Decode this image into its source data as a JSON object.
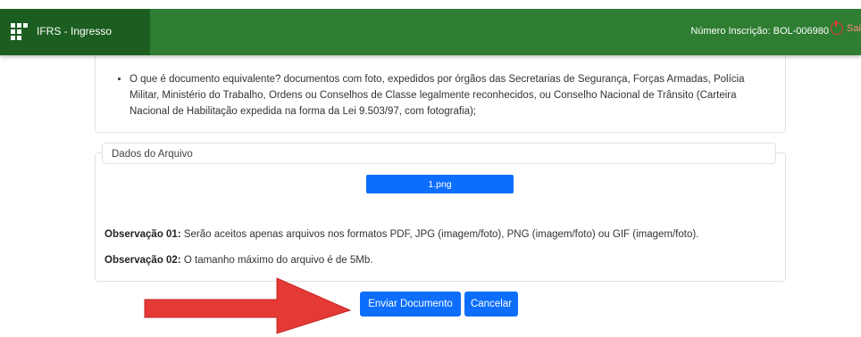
{
  "header": {
    "brand": "IFRS - Ingresso",
    "registration": "Número Inscrição: BOL-006980",
    "logout_label": "Sair"
  },
  "info": {
    "bullet": "O que é documento equivalente? documentos com foto, expedidos por órgãos das Secretarias de Segurança, Forças Armadas, Polícia Militar, Ministério do Trabalho, Ordens ou Conselhos de Classe legalmente reconhecidos, ou Conselho Nacional de Trânsito (Carteira Nacional de Habilitação expedida na forma da Lei 9.503/97, com fotografia);"
  },
  "file_section": {
    "legend": "Dados do Arquivo",
    "file_button": "1.png",
    "obs1_label": "Observação 01:",
    "obs1_text": " Serão aceitos apenas arquivos nos formatos PDF, JPG (imagem/foto), PNG (imagem/foto) ou GIF (imagem/foto).",
    "obs2_label": "Observação 02:",
    "obs2_text": " O tamanho máximo do arquivo é de 5Mb."
  },
  "actions": {
    "send": "Enviar Documento",
    "cancel": "Cancelar"
  },
  "colors": {
    "header": "#2e7d32",
    "primary": "#0d6efd",
    "arrow": "#e53935"
  },
  "icons": [
    "ifrs-logo-icon",
    "logout-icon",
    "red-arrow-annotation"
  ]
}
